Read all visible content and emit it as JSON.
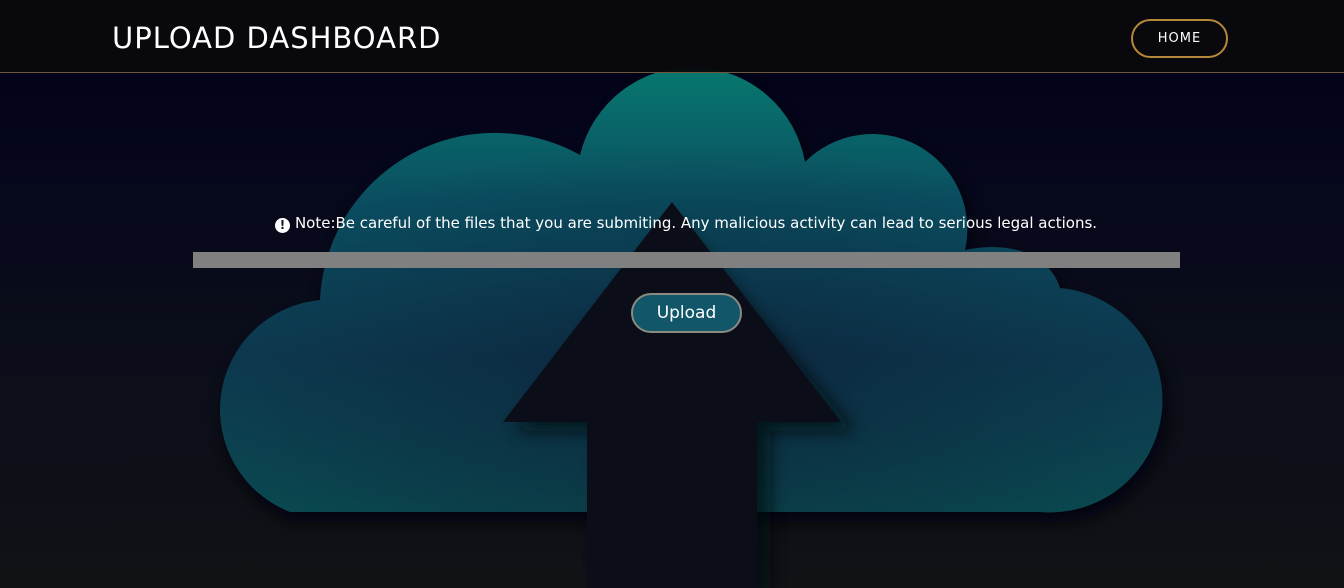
{
  "header": {
    "title": "UPLOAD DASHBOARD",
    "home_label": "HOME"
  },
  "main": {
    "note_icon": "!",
    "note_text": "Note:Be careful of the files that you are submiting. Any malicious activity can lead to serious legal actions.",
    "upload_label": "Upload"
  },
  "icons": {
    "background": "cloud-upload-icon",
    "note": "exclamation-circle-icon"
  },
  "colors": {
    "nav_border": "#6b5a3a",
    "home_border": "#b5883a",
    "upload_bg": "#12566a",
    "cloud_top": "#08756e",
    "cloud_bottom": "#0d3a45",
    "file_bar": "#808080"
  }
}
